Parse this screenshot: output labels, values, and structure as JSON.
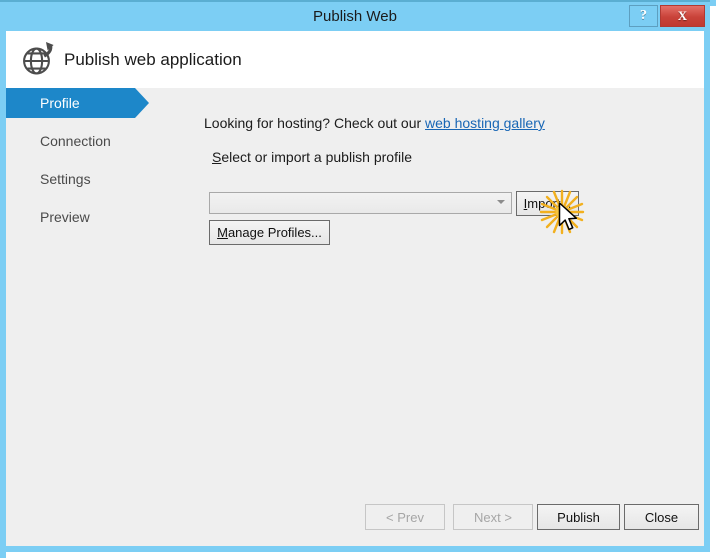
{
  "window": {
    "title": "Publish Web",
    "help_button_label": "?",
    "close_button_label": "X",
    "help_icon": "question-mark-icon",
    "close_icon": "close-x-icon"
  },
  "header": {
    "title": "Publish web application",
    "icon": "globe-publish-icon"
  },
  "sidebar": {
    "items": [
      {
        "label": "Profile",
        "selected": true
      },
      {
        "label": "Connection",
        "selected": false
      },
      {
        "label": "Settings",
        "selected": false
      },
      {
        "label": "Preview",
        "selected": false
      }
    ]
  },
  "content": {
    "hosting_prompt_prefix": "Looking for hosting? Check out our ",
    "hosting_link_text": "web hosting gallery",
    "profile_label_accel": "S",
    "profile_label_rest": "elect or import a publish profile",
    "profile_combo_value": "",
    "profile_combo_placeholder": "",
    "combo_icon": "chevron-down-icon",
    "import_button_accel": "I",
    "import_button_rest": "mport...",
    "manage_button_accel": "M",
    "manage_button_rest": "anage Profiles..."
  },
  "cursor": {
    "click_effect_icon": "click-burst-icon",
    "pointer_icon": "mouse-pointer-icon",
    "burst_color": "#f2b01e",
    "pointer_fill": "#ffffff",
    "pointer_stroke": "#000000"
  },
  "footer": {
    "buttons": [
      {
        "label": "< Prev",
        "enabled": false,
        "accel_index": 3
      },
      {
        "label": "Next >",
        "enabled": false,
        "accel_index": 2
      },
      {
        "label": "Publish",
        "enabled": true,
        "accel_index": 0
      },
      {
        "label": "Close",
        "enabled": true,
        "accel_index": 2
      }
    ]
  },
  "colors": {
    "title_bar": "#7ccef4",
    "title_bar_top_edge": "#5aaed2",
    "close_button": "#c9433a",
    "selected_nav": "#1d87c9",
    "body_background": "#efefef",
    "header_background": "#ffffff",
    "link": "#1866b5",
    "text": "#1b1b1b",
    "nav_text": "#4a4a4a",
    "disabled_text": "#a6a6a6"
  }
}
